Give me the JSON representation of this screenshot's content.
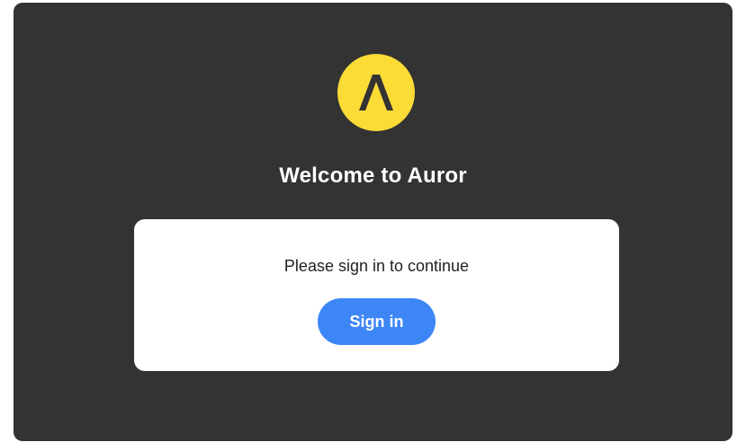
{
  "brand": {
    "logo_icon": "caret-up-icon",
    "logo_color": "#fbdb36",
    "logo_glyph_color": "#333333"
  },
  "page": {
    "background": "#333333",
    "welcome_title": "Welcome to Auror"
  },
  "signin_card": {
    "prompt": "Please sign in to continue",
    "button_label": "Sign in",
    "button_color": "#3d86f6"
  }
}
